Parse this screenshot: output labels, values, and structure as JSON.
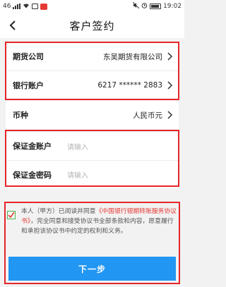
{
  "status_bar": {
    "carrier": "46",
    "time": "19:02"
  },
  "nav": {
    "title": "客户签约"
  },
  "account_info": {
    "futures_company_label": "期货公司",
    "futures_company_value": "东吴期货有限公司",
    "bank_account_label": "银行账户",
    "bank_account_value": "6217 ****** 2883"
  },
  "currency": {
    "label": "币种",
    "value": "人民币元"
  },
  "margin": {
    "account_label": "保证金账户",
    "account_placeholder": "请输入",
    "password_label": "保证金密码",
    "password_placeholder": "请输入"
  },
  "agreement": {
    "text_before": "本人（甲方）已阅读并同意",
    "link_text": "《中国银行银期转账服务协议书》",
    "text_after": "，完全同意和接受协议书全部条款和内容，愿意履行和承担该协议书中约定的权利和义务。",
    "checked": true
  },
  "actions": {
    "next_label": "下一步"
  },
  "colors": {
    "primary": "#2196f3",
    "link": "#e53935",
    "highlight": "#e5252a"
  }
}
